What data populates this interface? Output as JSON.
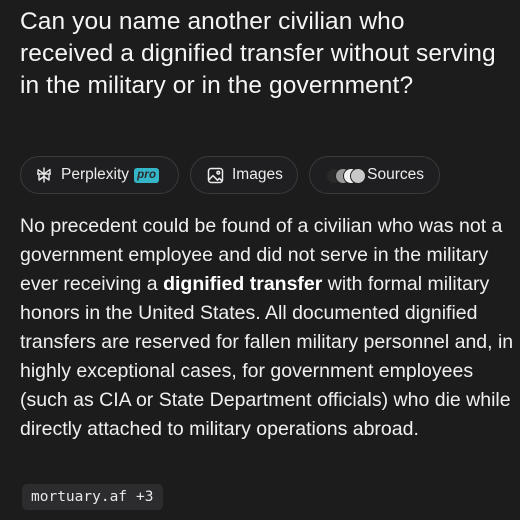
{
  "question": "Can you name another civilian who received a dignified transfer without serving in the military or in the government?",
  "tabs": {
    "perplexity": {
      "label": "Perplexity",
      "badge": "pro",
      "icon": "perplexity-icon"
    },
    "images": {
      "label": "Images",
      "icon": "image-icon"
    },
    "sources": {
      "label": "Sources",
      "icon": "source-favicons"
    }
  },
  "answer": {
    "part1": "No precedent could be found of a civilian who was not a government employee and did not serve in the military ever receiving a ",
    "bold": "dignified transfer",
    "part2": " with formal military honors in the United States. All documented dignified transfers are reserved for fallen military personnel and, in highly exceptional cases, for government employees (such as CIA or State Department officials) who die while directly attached to military operations abroad."
  },
  "citation": {
    "domain": "mortuary.af",
    "more": "+3"
  },
  "colors": {
    "background": "#1c1c1d",
    "pro_badge": "#35b6c8",
    "chip_border": "#3a3a3c",
    "citation_bg": "#2c2c2e"
  }
}
